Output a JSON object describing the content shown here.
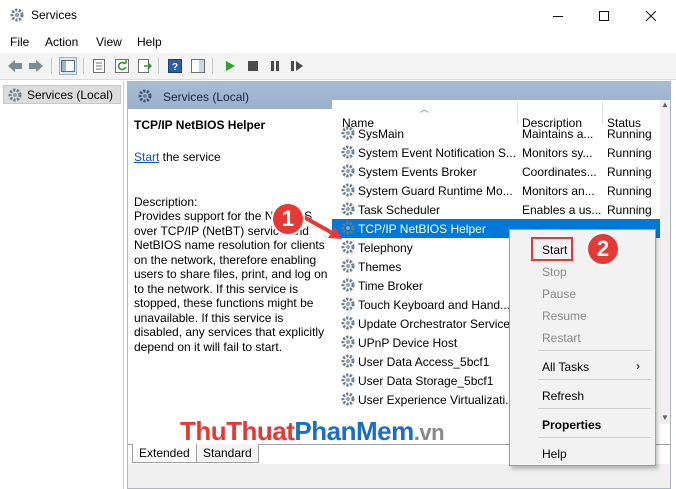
{
  "window": {
    "title": "Services",
    "icon": "services-gear-icon"
  },
  "menu": [
    "File",
    "Action",
    "View",
    "Help"
  ],
  "toolbar": [
    "back-arrow-icon",
    "forward-arrow-icon",
    "show-hide-tree-icon",
    "properties-icon",
    "refresh-icon",
    "export-list-icon",
    "help-icon",
    "action-pane-icon",
    "start-service-icon",
    "stop-service-icon",
    "pause-service-icon",
    "restart-service-icon"
  ],
  "tree": {
    "root_label": "Services (Local)"
  },
  "panel": {
    "header": "Services (Local)",
    "detail": {
      "service_title": "TCP/IP NetBIOS Helper",
      "start_link": "Start",
      "start_suffix": " the service",
      "description_label": "Description:",
      "description_text": "Provides support for the NetBIOS over TCP/IP (NetBT) service and NetBIOS name resolution for clients on the network, therefore enabling users to share files, print, and log on to the network. If this service is stopped, these functions might be unavailable. If this service is disabled, any services that explicitly depend on it will fail to start."
    },
    "columns": {
      "name": "Name",
      "description": "Description",
      "status": "Status"
    },
    "rows": [
      {
        "name": "SysMain",
        "description": "Maintains a...",
        "status": "Running"
      },
      {
        "name": "System Event Notification S...",
        "description": "Monitors sy...",
        "status": "Running"
      },
      {
        "name": "System Events Broker",
        "description": "Coordinates...",
        "status": "Running"
      },
      {
        "name": "System Guard Runtime Mo...",
        "description": "Monitors an...",
        "status": "Running"
      },
      {
        "name": "Task Scheduler",
        "description": "Enables a us...",
        "status": "Running"
      },
      {
        "name": "TCP/IP NetBIOS Helper",
        "description": "",
        "status": ""
      },
      {
        "name": "Telephony",
        "description": "",
        "status": ""
      },
      {
        "name": "Themes",
        "description": "",
        "status": ""
      },
      {
        "name": "Time Broker",
        "description": "",
        "status": ""
      },
      {
        "name": "Touch Keyboard and Hand...",
        "description": "",
        "status": ""
      },
      {
        "name": "Update Orchestrator Service",
        "description": "",
        "status": ""
      },
      {
        "name": "UPnP Device Host",
        "description": "",
        "status": ""
      },
      {
        "name": "User Data Access_5bcf1",
        "description": "",
        "status": ""
      },
      {
        "name": "User Data Storage_5bcf1",
        "description": "",
        "status": ""
      },
      {
        "name": "User Experience Virtualizati...",
        "description": "",
        "status": ""
      }
    ],
    "selected_row": "TCP/IP NetBIOS Helper",
    "tabs": [
      "Extended",
      "Standard"
    ]
  },
  "context_menu": {
    "items": [
      {
        "label": "Start",
        "enabled": true
      },
      {
        "label": "Stop",
        "enabled": false
      },
      {
        "label": "Pause",
        "enabled": false
      },
      {
        "label": "Resume",
        "enabled": false
      },
      {
        "label": "Restart",
        "enabled": false
      },
      {
        "label": "All Tasks",
        "enabled": true,
        "submenu": true
      },
      {
        "label": "Refresh",
        "enabled": true
      },
      {
        "label": "Properties",
        "enabled": true,
        "bold": true
      },
      {
        "label": "Help",
        "enabled": true
      }
    ]
  },
  "annotations": {
    "step1": "1",
    "step2": "2"
  },
  "watermark": {
    "part1": "ThuThuat",
    "part2": "PhanMem",
    "part3": ".vn"
  },
  "colors": {
    "selection": "#0078d7",
    "annotation_red": "#e53935",
    "header_blue": "#a7bcd4"
  }
}
